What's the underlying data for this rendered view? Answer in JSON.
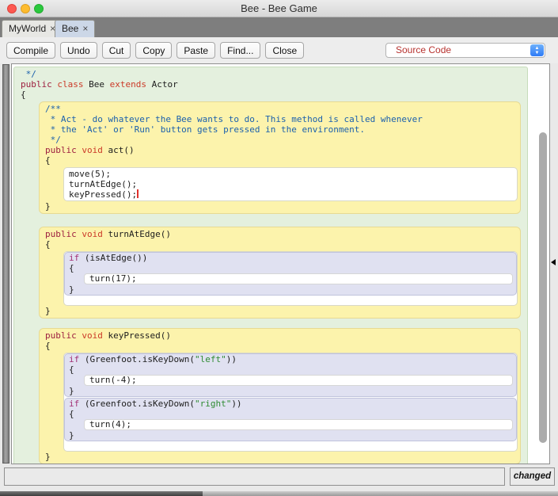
{
  "window": {
    "title": "Bee - Bee Game"
  },
  "tabbar": {
    "active_tab": "Bee",
    "tabs": [
      {
        "label": "MyWorld",
        "close_glyph": "×"
      },
      {
        "label": "Bee",
        "close_glyph": "×"
      }
    ]
  },
  "toolbar": {
    "buttons": [
      "Compile",
      "Undo",
      "Cut",
      "Copy",
      "Paste",
      "Find...",
      "Close"
    ],
    "view_selector": {
      "value": "Source Code",
      "arrow_up": "▲",
      "arrow_down": "▼"
    }
  },
  "statusbar": {
    "message": "",
    "state_label": "changed"
  },
  "colors": {
    "class_scope_bg": "#e4f0de",
    "method_scope_bg": "#fcf3ac",
    "if_scope_bg": "#e0e1f1",
    "keyword_access": "#9d1f3f",
    "keyword_type": "#cb3a28",
    "keyword_if": "#a33377",
    "comment": "#1b60ad",
    "string": "#2e8b32",
    "selector_text": "#b73330",
    "caret": "#e0312c"
  },
  "code": {
    "class_header": [
      [
        {
          "t": " */",
          "c": "cm"
        }
      ],
      [
        {
          "t": "public ",
          "c": "kw1"
        },
        {
          "t": "class ",
          "c": "kw2"
        },
        {
          "t": "Bee ",
          "c": "pl"
        },
        {
          "t": "extends ",
          "c": "kw2"
        },
        {
          "t": "Actor",
          "c": "pl"
        }
      ],
      [
        {
          "t": "{",
          "c": "pl"
        }
      ]
    ],
    "act": {
      "doc": [
        [
          {
            "t": "/**",
            "c": "cm"
          }
        ],
        [
          {
            "t": " * Act - do whatever the Bee wants to do. This method is called whenever",
            "c": "cm"
          }
        ],
        [
          {
            "t": " * the 'Act' or 'Run' button gets pressed in the environment.",
            "c": "cm"
          }
        ],
        [
          {
            "t": " */",
            "c": "cm"
          }
        ]
      ],
      "sig": [
        {
          "t": "public ",
          "c": "kw1"
        },
        {
          "t": "void ",
          "c": "kw2"
        },
        {
          "t": "act()",
          "c": "pl"
        }
      ],
      "open": [
        {
          "t": "{",
          "c": "pl"
        }
      ],
      "body": [
        [
          {
            "t": "move(5);",
            "c": "pl"
          }
        ],
        [
          {
            "t": "turnAtEdge();",
            "c": "pl"
          }
        ],
        [
          {
            "t": "keyPressed();",
            "c": "pl"
          }
        ]
      ],
      "close": [
        {
          "t": "}",
          "c": "pl"
        }
      ]
    },
    "turnAtEdge": {
      "sig": [
        {
          "t": "public ",
          "c": "kw1"
        },
        {
          "t": "void ",
          "c": "kw2"
        },
        {
          "t": "turnAtEdge()",
          "c": "pl"
        }
      ],
      "open": [
        {
          "t": "{",
          "c": "pl"
        }
      ],
      "if": {
        "cond": [
          {
            "t": "if ",
            "c": "kwif"
          },
          {
            "t": "(isAtEdge())",
            "c": "pl"
          }
        ],
        "open": [
          {
            "t": "{",
            "c": "pl"
          }
        ],
        "stmt": [
          {
            "t": "turn(17);",
            "c": "pl"
          }
        ],
        "close": [
          {
            "t": "}",
            "c": "pl"
          }
        ]
      },
      "close": [
        {
          "t": "}",
          "c": "pl"
        }
      ]
    },
    "keyPressed": {
      "sig": [
        {
          "t": "public ",
          "c": "kw1"
        },
        {
          "t": "void ",
          "c": "kw2"
        },
        {
          "t": "keyPressed()",
          "c": "pl"
        }
      ],
      "open": [
        {
          "t": "{",
          "c": "pl"
        }
      ],
      "if_left": {
        "cond": [
          {
            "t": "if ",
            "c": "kwif"
          },
          {
            "t": "(Greenfoot.isKeyDown(",
            "c": "pl"
          },
          {
            "t": "\"left\"",
            "c": "str"
          },
          {
            "t": "))",
            "c": "pl"
          }
        ],
        "open": [
          {
            "t": "{",
            "c": "pl"
          }
        ],
        "stmt": [
          {
            "t": "turn(-4);",
            "c": "pl"
          }
        ],
        "close": [
          {
            "t": "}",
            "c": "pl"
          }
        ]
      },
      "if_right": {
        "cond": [
          {
            "t": "if ",
            "c": "kwif"
          },
          {
            "t": "(Greenfoot.isKeyDown(",
            "c": "pl"
          },
          {
            "t": "\"right\"",
            "c": "str"
          },
          {
            "t": "))",
            "c": "pl"
          }
        ],
        "open": [
          {
            "t": "{",
            "c": "pl"
          }
        ],
        "stmt": [
          {
            "t": "turn(4);",
            "c": "pl"
          }
        ],
        "close": [
          {
            "t": "}",
            "c": "pl"
          }
        ]
      },
      "close": [
        {
          "t": "}",
          "c": "pl"
        }
      ]
    },
    "class_close": [
      {
        "t": "}",
        "c": "pl"
      }
    ]
  }
}
